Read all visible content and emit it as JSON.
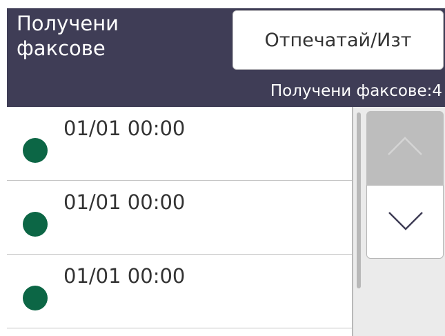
{
  "header": {
    "title": "Получени\nфаксове",
    "print_button_label": "Отпечатай/Изт",
    "count_label": "Получени факсове:4"
  },
  "fax_list": {
    "items": [
      {
        "label": "01/01 00:00",
        "status_icon": "green-dot-icon",
        "status_color": "#0c6645"
      },
      {
        "label": "01/01 00:00",
        "status_icon": "green-dot-icon",
        "status_color": "#0c6645"
      },
      {
        "label": "01/01 00:00",
        "status_icon": "green-dot-icon",
        "status_color": "#0c6645"
      }
    ]
  },
  "scroll": {
    "up_icon": "chevron-up-icon",
    "down_icon": "chevron-down-icon",
    "up_enabled": false,
    "down_enabled": true
  },
  "colors": {
    "header_background": "#3f3d56",
    "status_dot": "#0c6645",
    "disabled_button": "#bdbdbd"
  }
}
